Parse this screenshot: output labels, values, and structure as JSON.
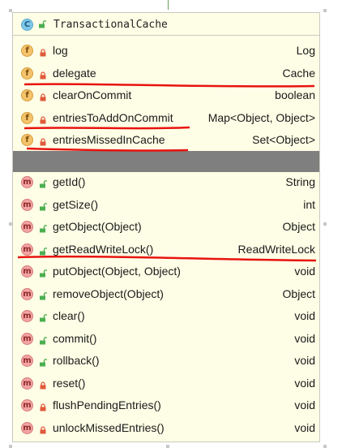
{
  "class": {
    "kind_badge": "C",
    "title": "TransactionalCache"
  },
  "fields": [
    {
      "badge": "f",
      "visibility": "private",
      "name": "log",
      "type": "Log"
    },
    {
      "badge": "f",
      "visibility": "private",
      "name": "delegate",
      "type": "Cache"
    },
    {
      "badge": "f",
      "visibility": "private",
      "name": "clearOnCommit",
      "type": "boolean"
    },
    {
      "badge": "f",
      "visibility": "private",
      "name": "entriesToAddOnCommit",
      "type": "Map<Object, Object>"
    },
    {
      "badge": "f",
      "visibility": "private",
      "name": "entriesMissedInCache",
      "type": "Set<Object>"
    }
  ],
  "methods": [
    {
      "badge": "m",
      "visibility": "public",
      "name": "getId()",
      "type": "String"
    },
    {
      "badge": "m",
      "visibility": "public",
      "name": "getSize()",
      "type": "int"
    },
    {
      "badge": "m",
      "visibility": "public",
      "name": "getObject(Object)",
      "type": "Object"
    },
    {
      "badge": "m",
      "visibility": "public",
      "name": "getReadWriteLock()",
      "type": "ReadWriteLock"
    },
    {
      "badge": "m",
      "visibility": "public",
      "name": "putObject(Object, Object)",
      "type": "void"
    },
    {
      "badge": "m",
      "visibility": "public",
      "name": "removeObject(Object)",
      "type": "Object"
    },
    {
      "badge": "m",
      "visibility": "public",
      "name": "clear()",
      "type": "void"
    },
    {
      "badge": "m",
      "visibility": "public",
      "name": "commit()",
      "type": "void"
    },
    {
      "badge": "m",
      "visibility": "public",
      "name": "rollback()",
      "type": "void"
    },
    {
      "badge": "m",
      "visibility": "private",
      "name": "reset()",
      "type": "void"
    },
    {
      "badge": "m",
      "visibility": "private",
      "name": "flushPendingEntries()",
      "type": "void"
    },
    {
      "badge": "m",
      "visibility": "private",
      "name": "unlockMissedEntries()",
      "type": "void"
    }
  ],
  "colors": {
    "annotation_red": "#e8130f",
    "private_lock": "#e05a3a",
    "public_lock": "#4caf50",
    "card_bg": "#fefee6",
    "separator": "#7f7f7f"
  },
  "icons": {
    "class_kind": "class-icon",
    "field": "field-icon",
    "method": "method-icon",
    "private": "lock-icon",
    "public": "unlock-icon"
  }
}
